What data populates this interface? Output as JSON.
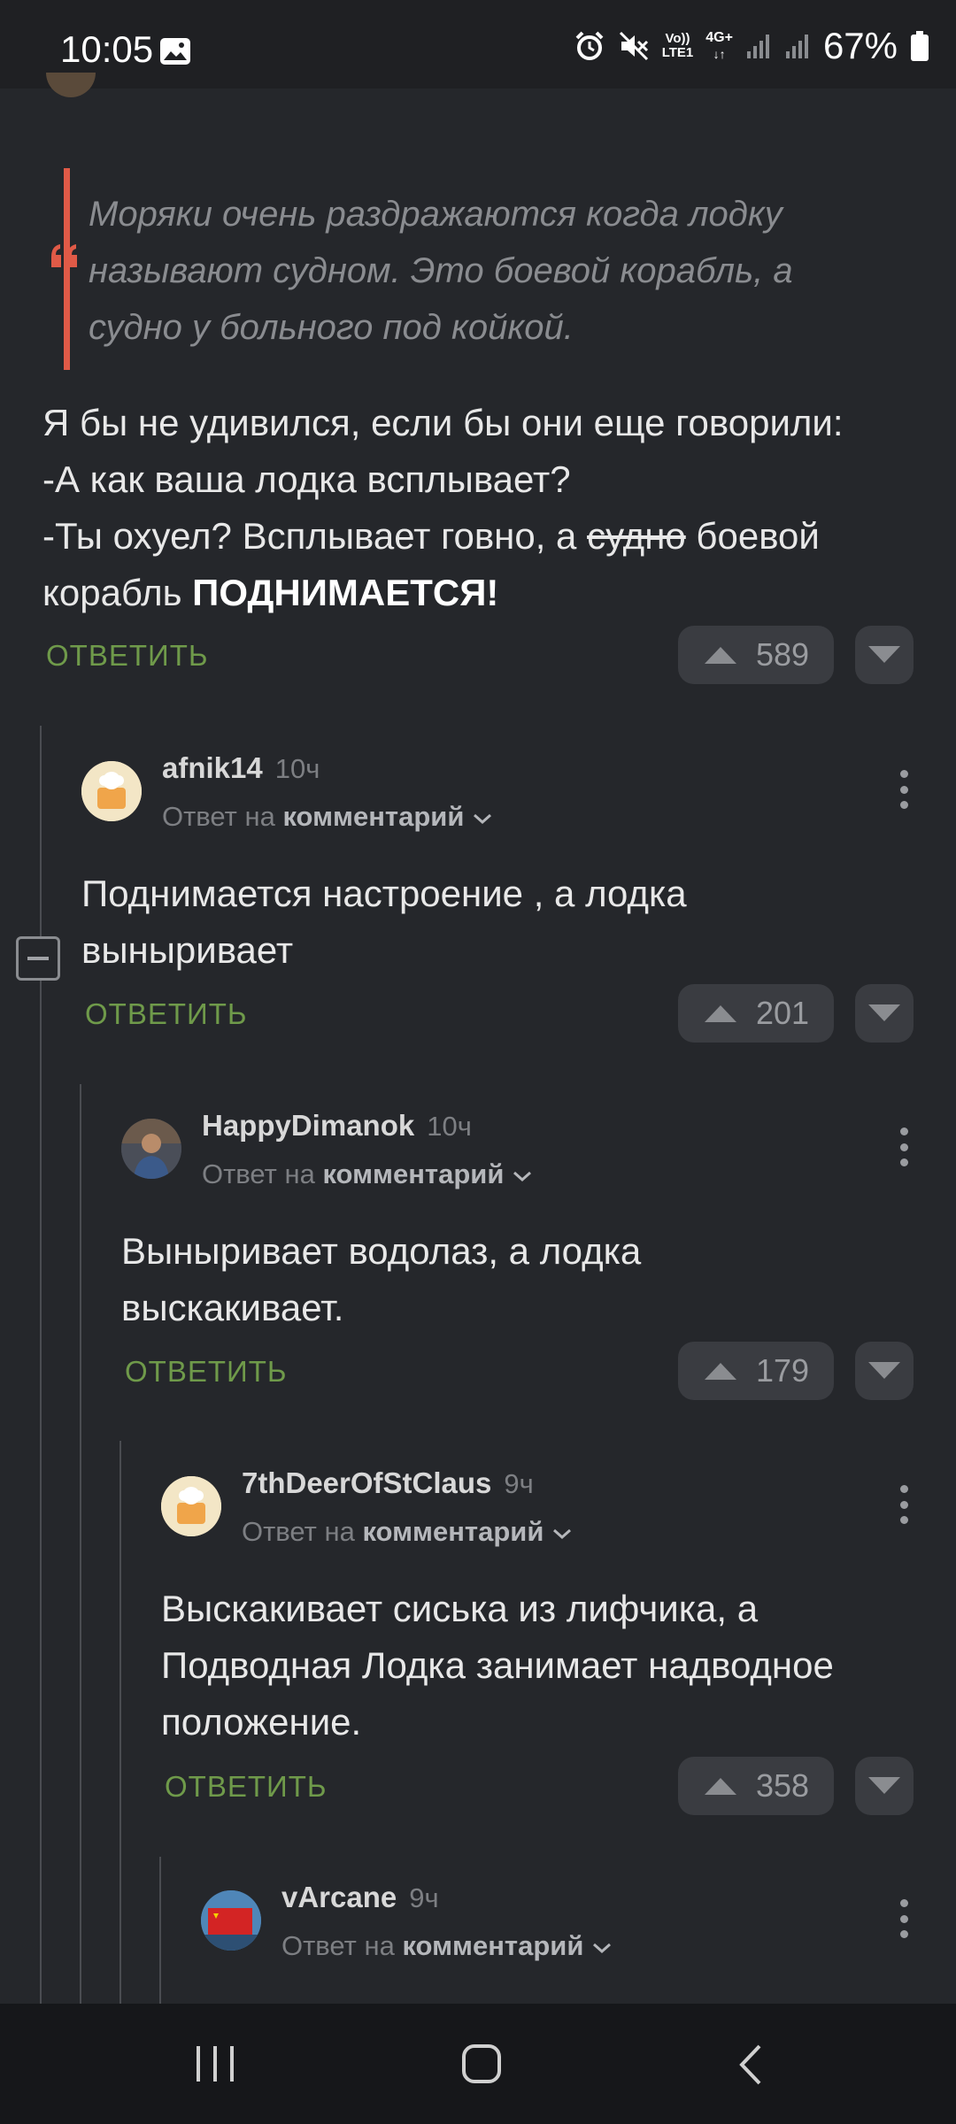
{
  "status_bar": {
    "time": "10:05",
    "network_label_top": "Vo))",
    "network_label_bottom": "LTE1",
    "network_type": "4G+",
    "battery": "67%",
    "icons": [
      "gallery-icon",
      "alarm-icon",
      "mute-icon",
      "volte-icon",
      "signal-icon",
      "signal-icon",
      "battery-icon"
    ]
  },
  "main_comment": {
    "quote": "Моряки очень раздражаются когда лодку называют судном. Это боевой корабль, а судно у больного под койкой.",
    "line1": "Я бы не удивился, если бы они еще говорили:",
    "line2": "-А как ваша лодка всплывает?",
    "line3_a": "-Ты охуел? Всплывает говно, а ",
    "line3_strike": "судно",
    "line3_b": " боевой корабль ",
    "line3_bold": "ПОДНИМАЕТСЯ!",
    "reply_label": "ОТВЕТИТЬ",
    "votes": "589"
  },
  "comments": [
    {
      "author": "afnik14",
      "ago": "10ч",
      "reply_to_prefix": "Ответ на",
      "reply_to_target": "комментарий",
      "text": "Поднимается настроение , а лодка выныривает",
      "reply_label": "ОТВЕТИТЬ",
      "votes": "201"
    },
    {
      "author": "HappyDimanok",
      "ago": "10ч",
      "reply_to_prefix": "Ответ на",
      "reply_to_target": "комментарий",
      "text": "Выныривает водолаз, а лодка выскакивает.",
      "reply_label": "ОТВЕТИТЬ",
      "votes": "179"
    },
    {
      "author": "7thDeerOfStClaus",
      "ago": "9ч",
      "reply_to_prefix": "Ответ на",
      "reply_to_target": "комментарий",
      "text": "Выскакивает сиська из лифчика, а Подводная Лодка занимает надводное положение.",
      "reply_label": "ОТВЕТИТЬ",
      "votes": "358"
    },
    {
      "author": "vArcane",
      "ago": "9ч",
      "reply_to_prefix": "Ответ на",
      "reply_to_target": "комментарий"
    }
  ],
  "colors": {
    "background": "#25272b",
    "accent_green": "#6f9a4a",
    "quote_bar": "#e05a47"
  }
}
